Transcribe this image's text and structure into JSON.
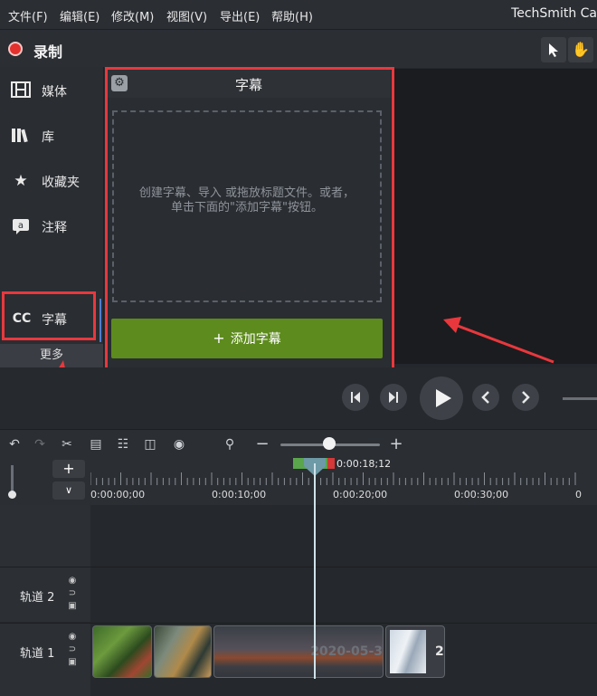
{
  "menu": {
    "items": [
      "文件(F)",
      "编辑(E)",
      "修改(M)",
      "视图(V)",
      "导出(E)",
      "帮助(H)"
    ],
    "app_title": "TechSmith Ca"
  },
  "record": {
    "label": "录制"
  },
  "sidebar": {
    "items": [
      {
        "label": "媒体",
        "icon": "film-icon"
      },
      {
        "label": "库",
        "icon": "library-icon"
      },
      {
        "label": "收藏夹",
        "icon": "star-icon"
      },
      {
        "label": "注释",
        "icon": "annotation-icon"
      },
      {
        "label": "字幕",
        "icon": "cc-icon"
      }
    ],
    "cc_glyph": "CC",
    "more_label": "更多"
  },
  "captions": {
    "title": "字幕",
    "hint": "创建字幕、导入 或拖放标题文件。或者，单击下面的\"添加字幕\"按钮。",
    "add_button_label": "添加字幕"
  },
  "timeline": {
    "current_time": "0:00:18;12",
    "ticks": [
      "0:00:00;00",
      "0:00:10;00",
      "0:00:20;00",
      "0:00:30;00",
      "0"
    ],
    "tracks": [
      {
        "label": "轨道 2"
      },
      {
        "label": "轨道 1"
      }
    ],
    "clip_date": "2020-05-3",
    "clip_tail": "2"
  },
  "colors": {
    "accent_green": "#5d8b1d",
    "record_red": "#e3312d",
    "annotation_red": "#e8383d"
  }
}
